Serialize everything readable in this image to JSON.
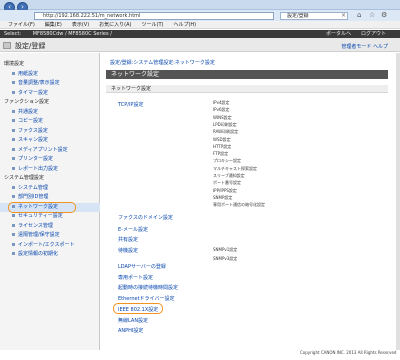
{
  "browser": {
    "address": "http://192.168.222.51/m_network.html",
    "tab_title": "設定/登録",
    "menu": [
      "ファイル(F)",
      "編集(E)",
      "表示(V)",
      "お気に入り(A)",
      "ツール(T)",
      "ヘルプ(H)"
    ]
  },
  "device": {
    "left": "Select:",
    "model": "MF8580Cdw / MF8580C Series /",
    "right": [
      "ポータルへ",
      "ログアウト"
    ]
  },
  "page": {
    "title": "設定/登録",
    "sub_right": "管理者モード ヘルプ"
  },
  "sidebar": {
    "items": [
      {
        "type": "section",
        "label": "環境設定"
      },
      {
        "type": "link",
        "label": "用紙設定"
      },
      {
        "type": "link",
        "label": "音量調整/表示設定"
      },
      {
        "type": "link",
        "label": "タイマー設定"
      },
      {
        "type": "section",
        "label": "ファンクション設定"
      },
      {
        "type": "link",
        "label": "共通設定"
      },
      {
        "type": "link",
        "label": "コピー設定"
      },
      {
        "type": "link",
        "label": "ファクス設定"
      },
      {
        "type": "link",
        "label": "スキャン設定"
      },
      {
        "type": "link",
        "label": "メディアプリント設定"
      },
      {
        "type": "link",
        "label": "プリンター設定"
      },
      {
        "type": "link",
        "label": "レポート出力設定"
      },
      {
        "type": "section",
        "label": "システム管理設定"
      },
      {
        "type": "link",
        "label": "システム管理"
      },
      {
        "type": "link",
        "label": "部門別ID管理"
      },
      {
        "type": "link",
        "label": "ネットワーク設定",
        "active": true
      },
      {
        "type": "link",
        "label": "セキュリティー設定"
      },
      {
        "type": "link",
        "label": "ライセンス管理"
      },
      {
        "type": "link",
        "label": "遠隔管理/保守設定"
      },
      {
        "type": "link",
        "label": "インポート/エクスポート"
      },
      {
        "type": "link",
        "label": "設定情報の初期化"
      }
    ]
  },
  "main": {
    "breadcrumb": "設定/登録:システム管理設定:ネットワーク設定",
    "section_title": "ネットワーク設定",
    "group_title": "ネットワーク設定",
    "links": [
      "TCP/IP設定",
      "ファクスのドメイン設定",
      "E-メール設定",
      "共有設定",
      "待機設定",
      "LDAPサーバーの登録",
      "専用ポート設定",
      "起動時の接続待機時間設定",
      "Ethernetドライバー設定",
      "IEEE 802.1X設定",
      "無線LAN設定",
      "ANPHI設定"
    ],
    "tcp_items": [
      "IPv4設定",
      "IPv6設定",
      "WINS設定",
      "LPD印刷設定",
      "RAW印刷設定",
      "WSD設定",
      "HTTP設定",
      "FTP設定",
      "プロキシー設定",
      "マルチキャスト探索設定",
      "スリープ通知設定",
      "ポート番号設定",
      "IPP/IPPS設定",
      "SNMP設定",
      "専用ポート通信の暗号化設定"
    ],
    "snmp_items": [
      "SNMPv1設定",
      "SNMPv3設定"
    ]
  },
  "footer": "Copyright CANON INC. 2013 All Rights Reserved"
}
